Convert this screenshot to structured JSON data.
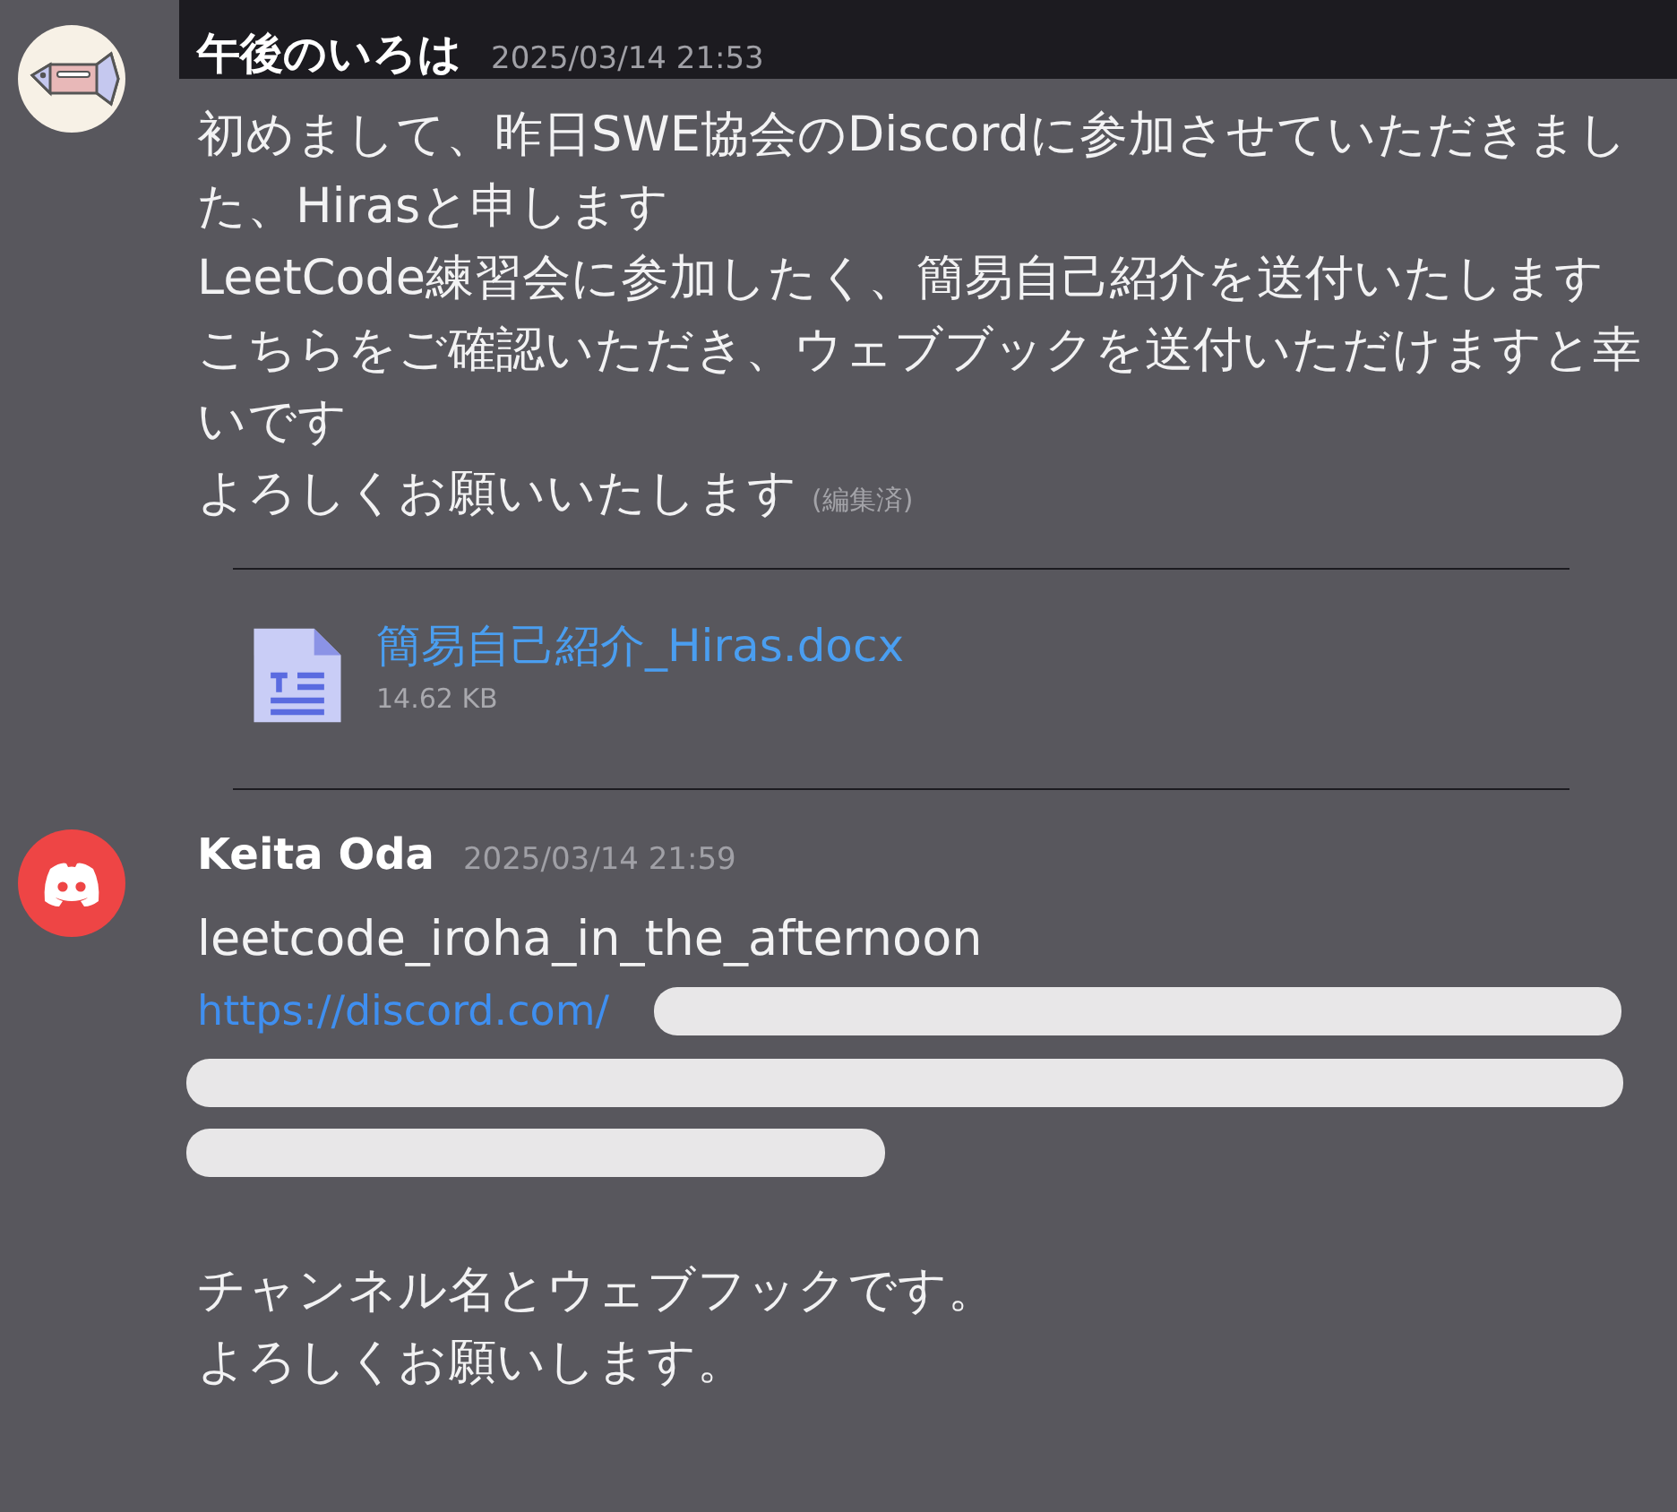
{
  "messages": [
    {
      "author": "午後のいろは",
      "avatar": {
        "kind": "fish"
      },
      "timestamp": "2025/03/14 21:53",
      "lines": [
        "初めまして、昨日SWE協会のDiscordに参加させていただきました、Hirasと申します",
        "LeetCode練習会に参加したく、簡易自己紹介を送付いたします",
        "こちらをご確認いただき、ウェブブックを送付いただけますと幸いです",
        "よろしくお願いいたします"
      ],
      "edited": "(編集済)",
      "attachment": {
        "filename": "簡易自己紹介_Hiras.docx",
        "size": "14.62 KB"
      }
    },
    {
      "author": "Keita Oda",
      "avatar": {
        "kind": "discord"
      },
      "timestamp": "2025/03/14 21:59",
      "lines": [
        "leetcode_iroha_in_the_afternoon"
      ],
      "link": "https://discord.com/",
      "after_lines": [
        "チャンネル名とウェブフックです。",
        "よろしくお願いします。"
      ]
    }
  ]
}
